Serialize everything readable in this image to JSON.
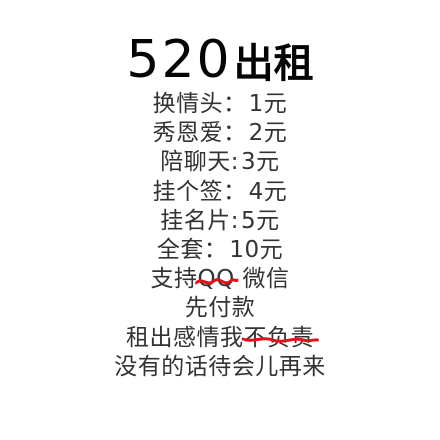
{
  "title": {
    "number": "520",
    "word": "出租"
  },
  "lines": [
    {
      "label": "换情头",
      "sep": "：",
      "value": "1元"
    },
    {
      "label": "秀恩爱",
      "sep": "：",
      "value": "2元"
    },
    {
      "label": "陪聊天",
      "sep": ":",
      "value": "3元"
    },
    {
      "label": "挂个签",
      "sep": "：",
      "value": "4元"
    },
    {
      "label": "挂名片",
      "sep": ":",
      "value": "5元"
    },
    {
      "label": "全套",
      "sep": "：",
      "value": "10元"
    },
    {
      "pre": "支持",
      "struck": "QQ",
      "post": " 微信"
    },
    {
      "text": "先付款"
    },
    {
      "pre": "租出感情我",
      "struck": "不负责"
    },
    {
      "text": "没有的话待会儿再来"
    }
  ],
  "colors": {
    "scribble": "#e0141b",
    "text": "#333333",
    "title": "#050505"
  }
}
